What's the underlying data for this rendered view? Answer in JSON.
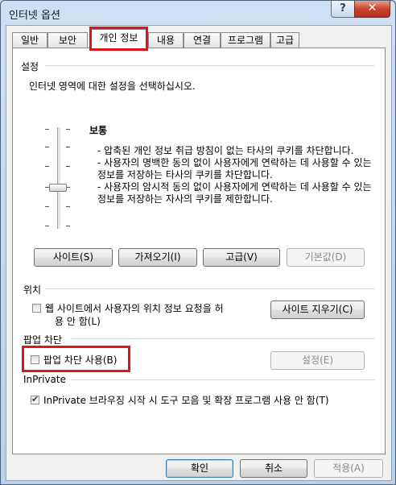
{
  "window": {
    "title": "인터넷 옵션"
  },
  "titlebar": {
    "help_glyph": "?",
    "close_glyph": "✕"
  },
  "tabs": [
    {
      "label": "일반"
    },
    {
      "label": "보안"
    },
    {
      "label": "개인 정보",
      "active": true
    },
    {
      "label": "내용"
    },
    {
      "label": "연결"
    },
    {
      "label": "프로그램"
    },
    {
      "label": "고급"
    }
  ],
  "settings": {
    "group_label": "설정",
    "instruction": "인터넷 영역에 대한 설정을 선택하십시오.",
    "level_label": "보통",
    "level_position": "middle",
    "description": [
      "- 압축된 개인 정보 취급 방침이 없는 타사의 쿠키를 차단합니다.",
      "- 사용자의 명백한 동의 없이 사용자에게 연락하는 데 사용할 수 있는 정보를 저장하는 타사의 쿠키를 차단합니다.",
      "- 사용자의 암시적 동의 없이 사용자에게 연락하는 데 사용할 수 있는 정보를 저장하는 자사의 쿠키를 제한합니다."
    ],
    "buttons": {
      "sites": "사이트(S)",
      "import": "가져오기(I)",
      "advanced": "고급(V)",
      "default": "기본값(D)"
    }
  },
  "location": {
    "group_label": "위치",
    "checkbox_line1": "웹 사이트에서 사용자의 위치 정보 요청을 허",
    "checkbox_line2": "용 안 함(L)",
    "checked": false,
    "clear_button": "사이트 지우기(C)"
  },
  "popup": {
    "group_label": "팝업 차단",
    "checkbox_label": "팝업 차단 사용(B)",
    "checked": false,
    "settings_button": "설정(E)"
  },
  "inprivate": {
    "group_label": "InPrivate",
    "checkbox_label": "InPrivate 브라우징 시작 시 도구 모음 및 확장 프로그램 사용 안 함(T)",
    "checked": true
  },
  "footer": {
    "ok": "확인",
    "cancel": "취소",
    "apply": "적용(A)"
  },
  "colors": {
    "highlight": "#e0141c",
    "close_button": "#c7452f",
    "checkmark": "#1d3f6e"
  }
}
